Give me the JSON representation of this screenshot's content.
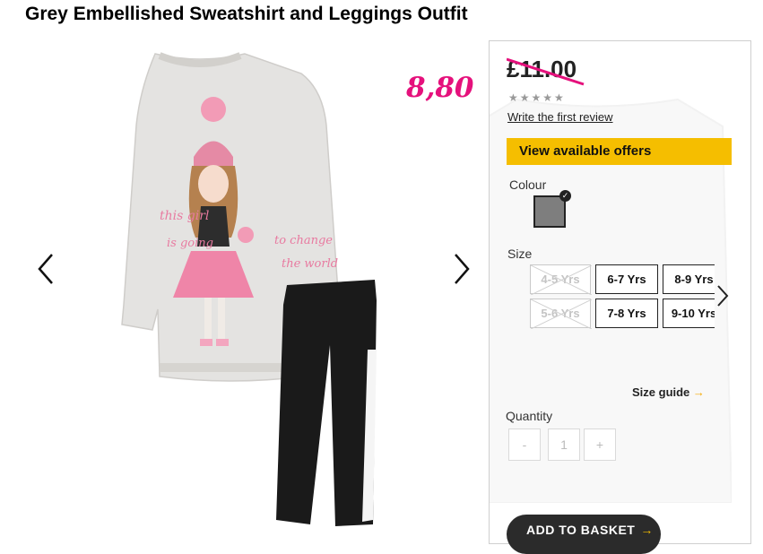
{
  "product": {
    "title": "Grey Embellished Sweatshirt and Leggings Outfit",
    "promo_price": "8,80"
  },
  "panel": {
    "old_price": "£11.00",
    "stars": "★★★★★",
    "review_link": "Write the first review",
    "offers_button": "View available offers",
    "colour_label": "Colour",
    "size_label": "Size",
    "sizes": [
      {
        "label": "4-5 Yrs",
        "available": false
      },
      {
        "label": "6-7 Yrs",
        "available": true
      },
      {
        "label": "8-9 Yrs",
        "available": true
      },
      {
        "label": "5-6 Yrs",
        "available": false
      },
      {
        "label": "7-8 Yrs",
        "available": true
      },
      {
        "label": "9-10 Yrs",
        "available": true
      }
    ],
    "size_guide": "Size guide",
    "size_guide_arrow": "→",
    "quantity_label": "Quantity",
    "quantity": {
      "minus": "-",
      "value": "1",
      "plus": "+"
    },
    "add_to_basket": "ADD TO BASKET",
    "add_to_basket_arrow": "→"
  },
  "colors": {
    "accent_yellow": "#f5be00",
    "promo_pink": "#e5117c",
    "selected_swatch": "#7e7e7e"
  }
}
